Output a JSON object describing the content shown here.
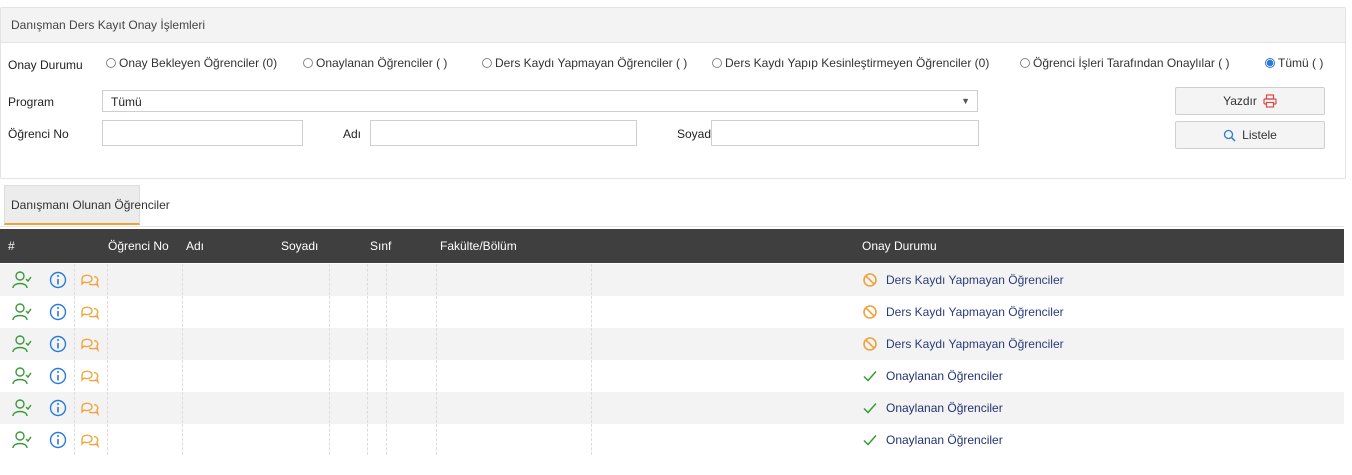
{
  "panel": {
    "title": "Danışman Ders Kayıt Onay İşlemleri"
  },
  "filters": {
    "status_label": "Onay Durumu",
    "radios": [
      {
        "label": "Onay Bekleyen Öğrenciler (0)",
        "selected": false
      },
      {
        "label": "Onaylanan Öğrenciler ( )",
        "selected": false
      },
      {
        "label": "Ders Kaydı Yapmayan Öğrenciler ( )",
        "selected": false
      },
      {
        "label": "Ders Kaydı Yapıp Kesinleştirmeyen Öğrenciler (0)",
        "selected": false
      },
      {
        "label": "Öğrenci İşleri Tarafından Onaylılar ( )",
        "selected": false
      },
      {
        "label": "Tümü ( )",
        "selected": true
      }
    ],
    "program_label": "Program",
    "program_value": "Tümü",
    "student_no_label": "Öğrenci No",
    "name_label": "Adı",
    "surname_label": "Soyadı",
    "print_label": "Yazdır",
    "list_label": "Listele"
  },
  "tab": {
    "label": "Danışmanı Olunan Öğrenciler"
  },
  "table": {
    "headers": [
      "#",
      "Öğrenci No",
      "Adı",
      "Soyadı",
      "Sınf",
      "Fakülte/Bölüm",
      "Onay Durumu"
    ],
    "rows": [
      {
        "status": "Ders Kaydı Yapmayan Öğrenciler",
        "kind": "ban"
      },
      {
        "status": "Ders Kaydı Yapmayan Öğrenciler",
        "kind": "ban"
      },
      {
        "status": "Ders Kaydı Yapmayan Öğrenciler",
        "kind": "ban"
      },
      {
        "status": "Onaylanan Öğrenciler",
        "kind": "check"
      },
      {
        "status": "Onaylanan Öğrenciler",
        "kind": "check"
      },
      {
        "status": "Onaylanan Öğrenciler",
        "kind": "check"
      }
    ]
  },
  "colors": {
    "accent": "#f0a23a",
    "green": "#3a9a3a",
    "blue": "#2a7ad6",
    "orange": "#f0a23a",
    "header_bg": "#3f3f3f"
  }
}
